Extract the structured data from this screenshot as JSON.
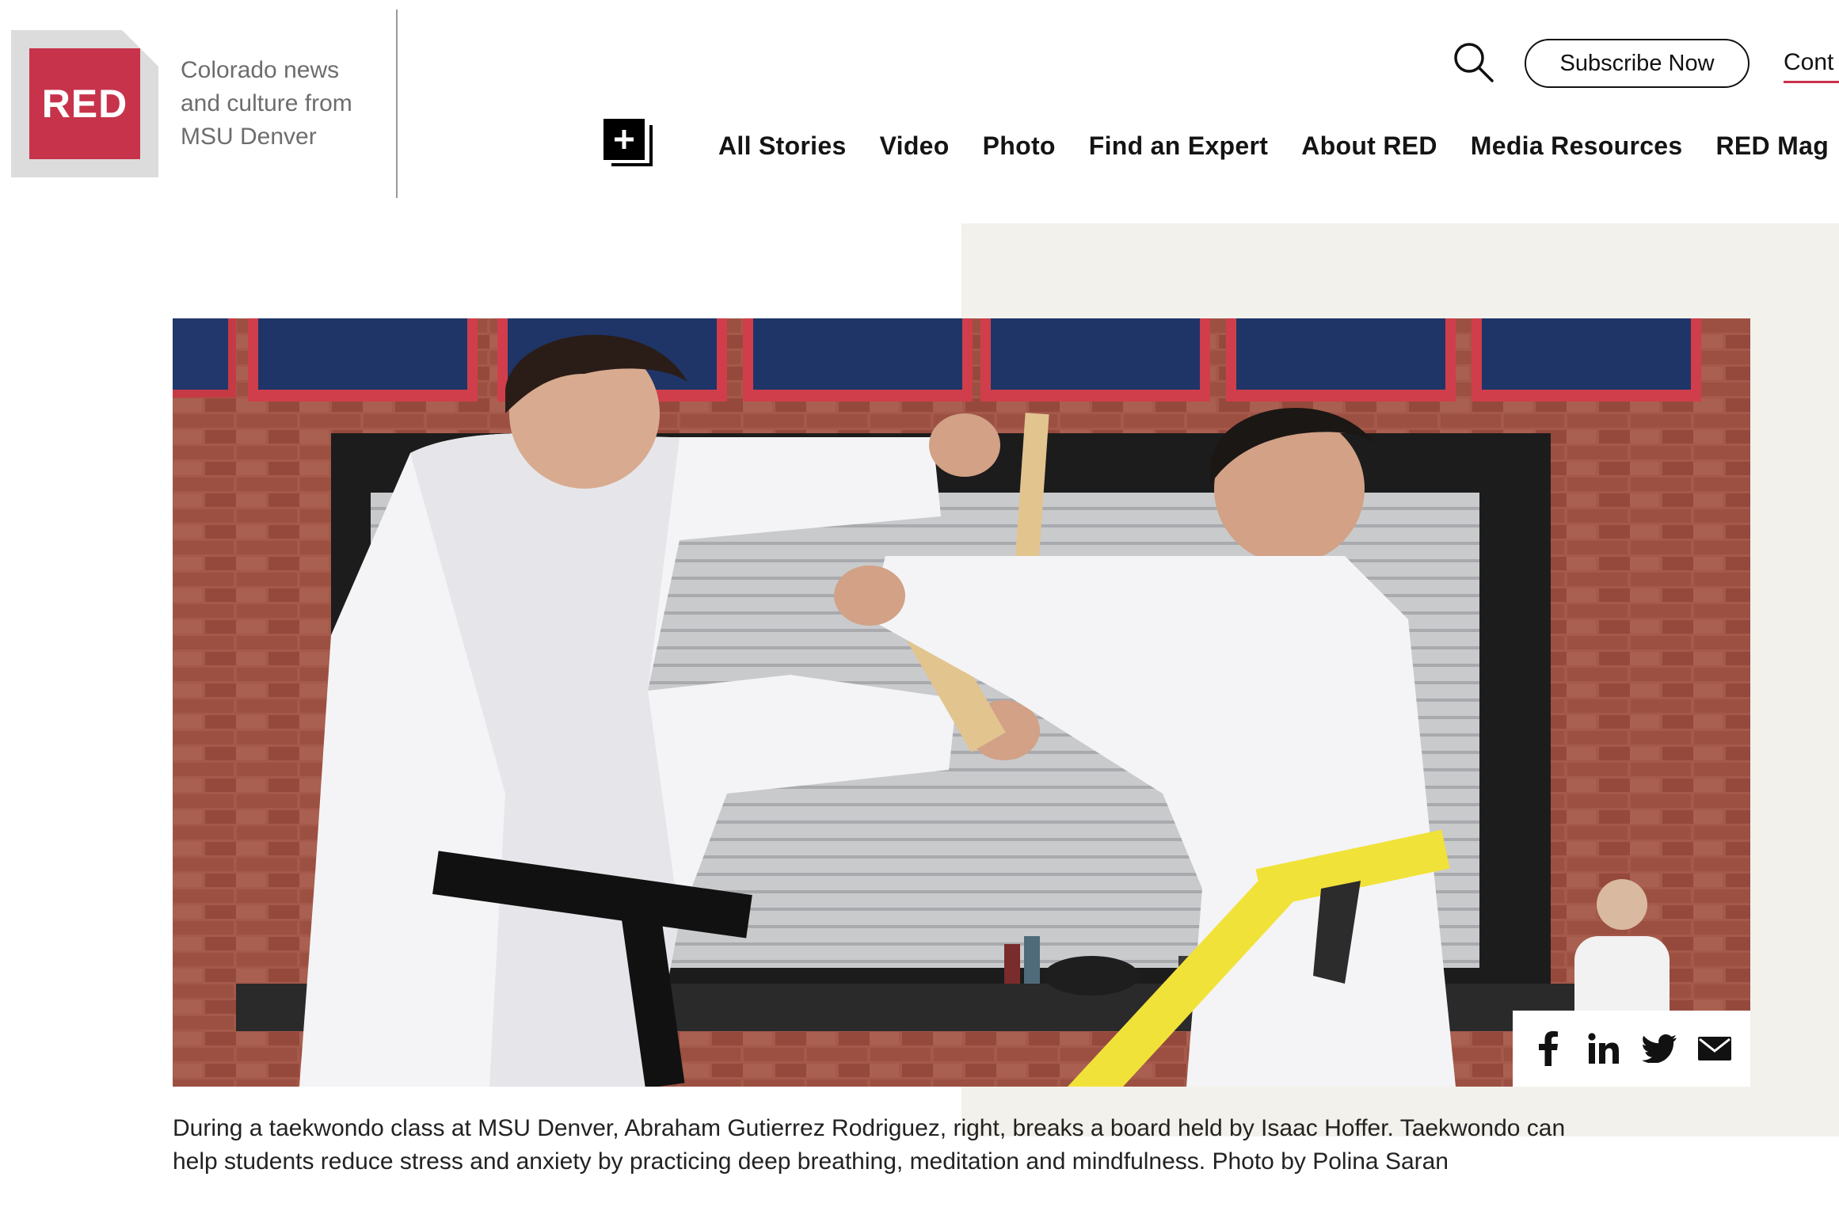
{
  "brand": {
    "logo_text": "RED",
    "tagline_line1": "Colorado news",
    "tagline_line2": "and culture from",
    "tagline_line3": "MSU Denver",
    "accent_color": "#c7334b"
  },
  "header": {
    "subscribe_label": "Subscribe Now",
    "contact_label": "Cont",
    "search_icon": "search-icon",
    "plus_icon": "add-square-icon"
  },
  "nav": {
    "items": [
      {
        "label": "All Stories"
      },
      {
        "label": "Video"
      },
      {
        "label": "Photo"
      },
      {
        "label": "Find an Expert"
      },
      {
        "label": "About RED"
      },
      {
        "label": "Media Resources"
      },
      {
        "label": "RED Mag"
      }
    ]
  },
  "article": {
    "image_alt": "Taekwondo board break during class",
    "caption": "During a taekwondo class at MSU Denver, Abraham Gutierrez Rodriguez, right, breaks a board held by Isaac Hoffer. Taekwondo can help students reduce stress and anxiety by practicing deep breathing, meditation and mindfulness. Photo by Polina Saran"
  },
  "share": {
    "icons": [
      "facebook-icon",
      "linkedin-icon",
      "twitter-icon",
      "email-icon"
    ]
  }
}
